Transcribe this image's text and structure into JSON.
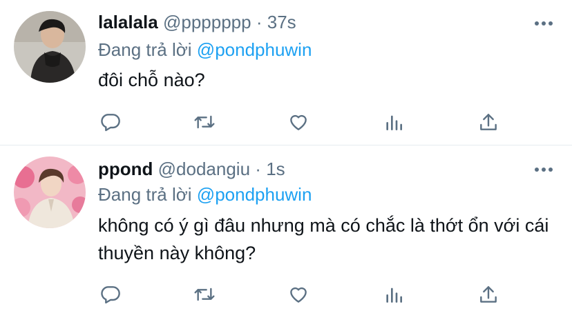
{
  "tweets": [
    {
      "name": "lalalala",
      "handle": "@ppppppp",
      "separator": "·",
      "time": "37s",
      "reply_prefix": "Đang trả lời",
      "reply_to": "@pondphuwin",
      "text": "đôi chỗ nào?"
    },
    {
      "name": "ppond",
      "handle": "@dodangiu",
      "separator": "·",
      "time": "1s",
      "reply_prefix": "Đang trả lời",
      "reply_to": "@pondphuwin",
      "text": "không có ý gì đâu nhưng mà có chắc là thớt ổn với cái thuyền này không?"
    }
  ],
  "icons": [
    "more-icon",
    "reply-icon",
    "retweet-icon",
    "like-icon",
    "analytics-icon",
    "share-icon"
  ],
  "colors": {
    "text": "#0f1419",
    "secondary": "#5b7083",
    "link": "#1da1f2",
    "divider": "#e6ecf0"
  }
}
